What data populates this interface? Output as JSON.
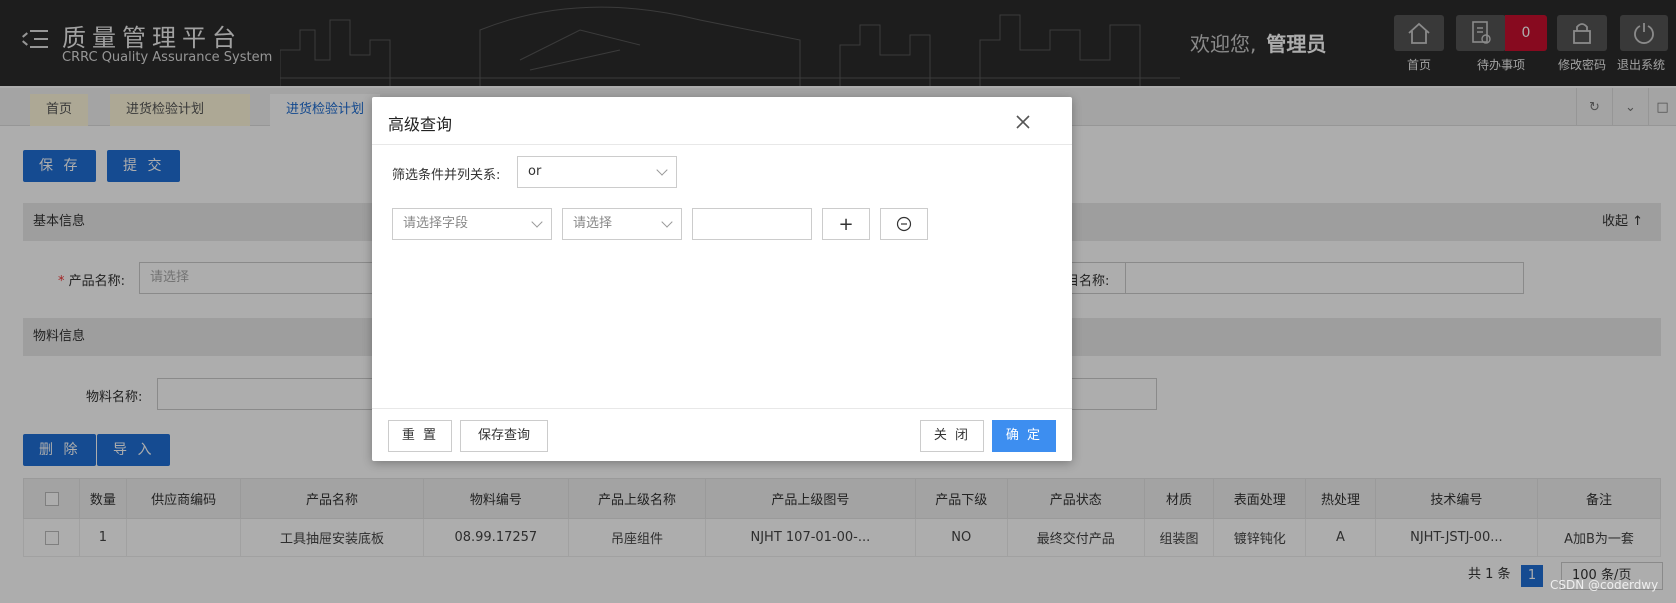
{
  "header": {
    "title": "质量管理平台",
    "subtitle": "CRRC Quality Assurance System",
    "welcome": "欢迎您,",
    "user": "管理员",
    "buttons": [
      {
        "label": "首页",
        "icon": "home-icon"
      },
      {
        "label": "待办事项",
        "icon": "todo-icon",
        "badge": "0"
      },
      {
        "label": "修改密码",
        "icon": "lock-icon"
      },
      {
        "label": "退出系统",
        "icon": "power-icon"
      }
    ]
  },
  "tabs": [
    "首页",
    "进货检验计划",
    "进货检验计划"
  ],
  "toolbar": {
    "save": "保 存",
    "submit": "提 交"
  },
  "basic": {
    "title": "基本信息",
    "collapse": "收起",
    "product_label": "产品名称:",
    "product_placeholder": "请选择",
    "project_label": "目名称:"
  },
  "material": {
    "title": "物料信息",
    "name_label": "物料名称:"
  },
  "actions": {
    "delete": "删 除",
    "import": "导 入"
  },
  "table": {
    "columns": [
      "数量",
      "供应商编码",
      "产品名称",
      "物料编号",
      "产品上级名称",
      "产品上级图号",
      "产品下级",
      "产品状态",
      "材质",
      "表面处理",
      "热处理",
      "技术编号",
      "备注"
    ],
    "rows": [
      [
        "1",
        "",
        "工具抽屉安装底板",
        "08.99.17257",
        "吊座组件",
        "NJHT 107-01-00-...",
        "NO",
        "最终交付产品",
        "组装图",
        "镀锌钝化",
        "A",
        "NJHT-JSTJ-00...",
        "A加B为一套"
      ]
    ]
  },
  "pager": {
    "total": "共 1 条",
    "page": "1",
    "size": "100 条/页"
  },
  "modal": {
    "title": "高级查询",
    "relation_label": "筛选条件并列关系:",
    "relation_value": "or",
    "field_placeholder": "请选择字段",
    "op_placeholder": "请选择",
    "reset": "重 置",
    "save_query": "保存查询",
    "close": "关 闭",
    "confirm": "确 定"
  },
  "watermark": "CSDN @coderdwy"
}
